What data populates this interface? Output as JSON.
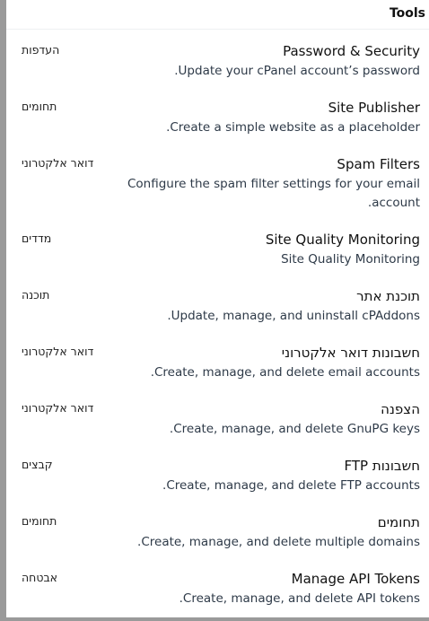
{
  "header": {
    "title": "Tools"
  },
  "items": [
    {
      "title": "Password & Security",
      "desc": "Update your cPanel account’s password.",
      "category": "העדפות"
    },
    {
      "title": "Site Publisher",
      "desc": "Create a simple website as a placeholder.",
      "category": "תחומים"
    },
    {
      "title": "Spam Filters",
      "desc": "Configure the spam filter settings for your email account.",
      "category": "דואר אלקטרוני"
    },
    {
      "title": "Site Quality Monitoring",
      "desc": "Site Quality Monitoring",
      "category": "מדדים"
    },
    {
      "title": "תוכנת אתר",
      "desc": "Update, manage, and uninstall cPAddons.",
      "category": "תוכנה"
    },
    {
      "title": "חשבונות דואר אלקטרוני",
      "desc": "Create, manage, and delete email accounts.",
      "category": "דואר אלקטרוני"
    },
    {
      "title": "הצפנה",
      "desc": "Create, manage, and delete GnuPG keys.",
      "category": "דואר אלקטרוני"
    },
    {
      "title": "חשבונות FTP",
      "desc": "Create, manage, and delete FTP accounts.",
      "category": "קבצים"
    },
    {
      "title": "תחומים",
      "desc": "Create, manage, and delete multiple domains.",
      "category": "תחומים"
    },
    {
      "title": "Manage API Tokens",
      "desc": "Create, manage, and delete API tokens.",
      "category": "אבטחה"
    }
  ]
}
